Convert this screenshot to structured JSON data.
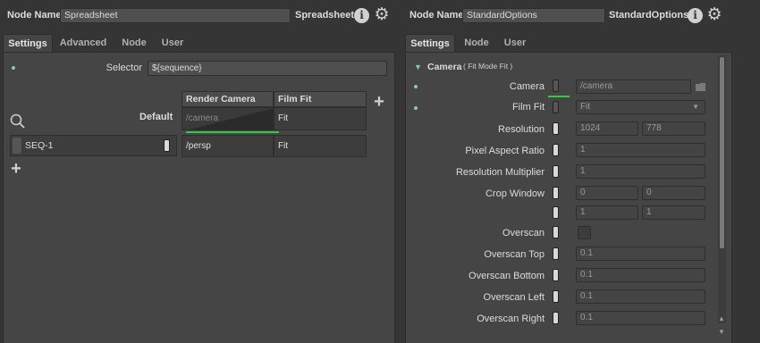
{
  "left": {
    "node_name_label": "Node Name",
    "node_name_value": "Spreadsheet",
    "node_type": "Spreadsheet",
    "tabs": [
      {
        "label": "Settings",
        "active": true
      },
      {
        "label": "Advanced",
        "active": false
      },
      {
        "label": "Node",
        "active": false
      },
      {
        "label": "User",
        "active": false
      }
    ],
    "selector_label": "Selector",
    "selector_value": "${sequence}",
    "columns": [
      "Render Camera",
      "Film Fit"
    ],
    "default_row": {
      "label": "Default",
      "render_camera": "/camera",
      "film_fit": "Fit"
    },
    "rows": [
      {
        "name": "SEQ-1",
        "render_camera": "/persp",
        "film_fit": "Fit"
      }
    ]
  },
  "right": {
    "node_name_label": "Node Name",
    "node_name_value": "StandardOptions",
    "node_type": "StandardOptions",
    "tabs": [
      {
        "label": "Settings",
        "active": true
      },
      {
        "label": "Node",
        "active": false
      },
      {
        "label": "User",
        "active": false
      }
    ],
    "section_title": "Camera",
    "section_subtitle": "( Fit Mode Fit )",
    "params": {
      "camera": {
        "label": "Camera",
        "value": "/camera"
      },
      "film_fit": {
        "label": "Film Fit",
        "value": "Fit"
      },
      "resolution": {
        "label": "Resolution",
        "x": "1024",
        "y": "778"
      },
      "pixel_aspect": {
        "label": "Pixel Aspect Ratio",
        "value": "1"
      },
      "res_mult": {
        "label": "Resolution Multiplier",
        "value": "1"
      },
      "crop": {
        "label": "Crop Window",
        "min_x": "0",
        "min_y": "0",
        "max_x": "1",
        "max_y": "1"
      },
      "overscan": {
        "label": "Overscan"
      },
      "overscan_top": {
        "label": "Overscan Top",
        "value": "0.1"
      },
      "overscan_bottom": {
        "label": "Overscan Bottom",
        "value": "0.1"
      },
      "overscan_left": {
        "label": "Overscan Left",
        "value": "0.1"
      },
      "overscan_right": {
        "label": "Overscan Right",
        "value": "0.1"
      }
    }
  },
  "colors": {
    "accent_green": "#2ecc40",
    "dot_green": "#7ed39b"
  }
}
